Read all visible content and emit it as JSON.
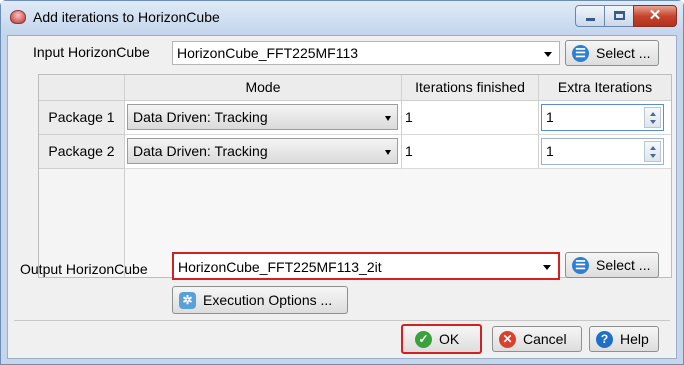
{
  "window": {
    "title": "Add iterations to HorizonCube"
  },
  "input": {
    "label": "Input HorizonCube",
    "value": "HorizonCube_FFT225MF113",
    "select_label": "Select ..."
  },
  "table": {
    "columns": [
      "Mode",
      "Iterations finished",
      "Extra Iterations"
    ],
    "rows": [
      {
        "name": "Package 1",
        "mode": "Data Driven: Tracking",
        "finished": "1",
        "extra": "1"
      },
      {
        "name": "Package 2",
        "mode": "Data Driven: Tracking",
        "finished": "1",
        "extra": "1"
      }
    ]
  },
  "output": {
    "label": "Output HorizonCube",
    "value": "HorizonCube_FFT225MF113_2it",
    "select_label": "Select ..."
  },
  "execution_options_label": "Execution Options ...",
  "footer": {
    "ok_label": "OK",
    "cancel_label": "Cancel",
    "help_label": "Help"
  },
  "colors": {
    "highlight": "#d32020",
    "ok_icon": "#3aa23a",
    "cancel_icon": "#d9412f",
    "help_icon": "#1f6fc6",
    "select_icon": "#2f7fd0"
  },
  "icons": {
    "app": "app-icon",
    "select": "select-icon",
    "execution": "gear-icon",
    "ok": "check-icon",
    "cancel": "x-icon",
    "help": "question-icon"
  }
}
